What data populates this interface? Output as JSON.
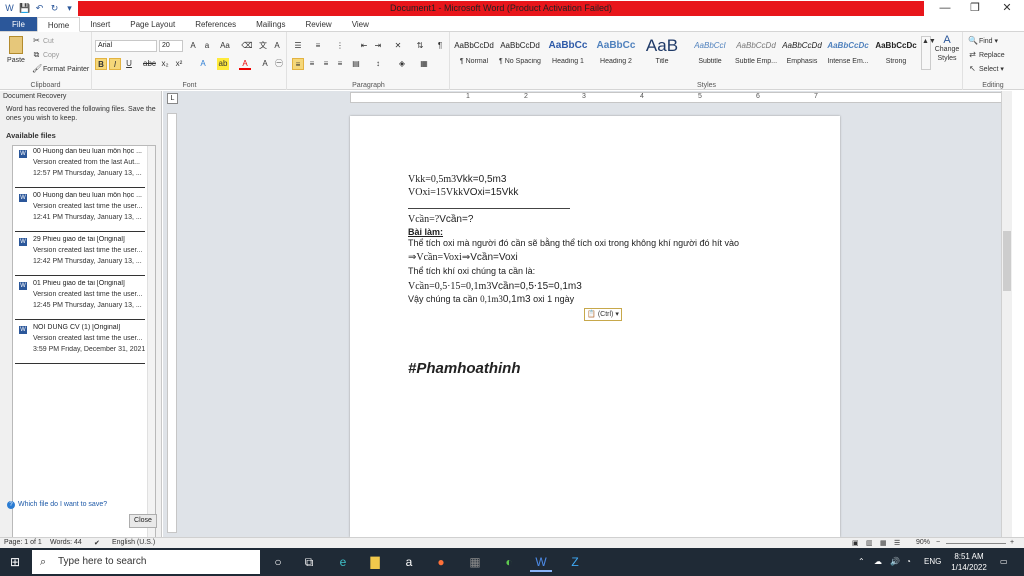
{
  "window": {
    "title": "Document1 - Microsoft Word (Product Activation Failed)",
    "qat": [
      "save-icon",
      "undo-icon",
      "redo-icon",
      "customize-icon"
    ]
  },
  "tabs": [
    "File",
    "Home",
    "Insert",
    "Page Layout",
    "References",
    "Mailings",
    "Review",
    "View"
  ],
  "ribbon": {
    "clipboard": {
      "label": "Clipboard",
      "paste": "Paste",
      "cut": "Cut",
      "copy": "Copy",
      "format_painter": "Format Painter"
    },
    "font": {
      "label": "Font",
      "family": "Arial",
      "size": "20"
    },
    "paragraph": {
      "label": "Paragraph"
    },
    "styles": {
      "label": "Styles",
      "items": [
        {
          "sample": "AaBbCcDd",
          "name": "¶ Normal"
        },
        {
          "sample": "AaBbCcDd",
          "name": "¶ No Spacing"
        },
        {
          "sample": "AaBbCc",
          "name": "Heading 1"
        },
        {
          "sample": "AaBbCc",
          "name": "Heading 2"
        },
        {
          "sample": "AaB",
          "name": "Title"
        },
        {
          "sample": "AaBbCcI",
          "name": "Subtitle"
        },
        {
          "sample": "AaBbCcDd",
          "name": "Subtle Emp..."
        },
        {
          "sample": "AaBbCcDd",
          "name": "Emphasis"
        },
        {
          "sample": "AaBbCcDc",
          "name": "Intense Em..."
        },
        {
          "sample": "AaBbCcDc",
          "name": "Strong"
        }
      ],
      "change_styles": "Change Styles"
    },
    "editing": {
      "label": "Editing",
      "find": "Find",
      "replace": "Replace",
      "select": "Select"
    }
  },
  "recovery": {
    "title": "Document Recovery",
    "message": "Word has recovered the following files.  Save the ones you wish to keep.",
    "available": "Available files",
    "files": [
      {
        "name": "00 Huong dan tieu luan môn học ...",
        "desc": "Version created from the last Aut...",
        "time": "12:57 PM Thursday, January 13, ..."
      },
      {
        "name": "00 Huong dan tieu luan môn học ...",
        "desc": "Version created last time the user...",
        "time": "12:41 PM Thursday, January 13, ..."
      },
      {
        "name": "29 Phieu giao de tai  [Original]",
        "desc": "Version created last time the user...",
        "time": "12:42 PM Thursday, January 13, ..."
      },
      {
        "name": "01 Phieu giao de tai  [Original]",
        "desc": "Version created last time the user...",
        "time": "12:45 PM Thursday, January 13, ..."
      },
      {
        "name": "NOI DUNG CV (1)  [Original]",
        "desc": "Version created last time the user...",
        "time": "3:59 PM Friday, December 31, 2021"
      }
    ],
    "help": "Which file do I want to save?",
    "close": "Close"
  },
  "document": {
    "line1_serif": "Vkk=0,5m3",
    "line1_text": "Vkk=0,5m3",
    "line2_serif": "VOxi=15Vkk",
    "line2_text": "VOxi=15Vkk",
    "line3_serif": "Vcần=?",
    "line3_text": "Vcần=?",
    "line4": "Bài làm:",
    "line5": "Thể tích oxi mà người đó cần sẽ bằng thể tích oxi trong không khí người đó hít vào",
    "line6_serif": "⇒Vcần=Voxi",
    "line6_text": "⇒Vcần=Voxi",
    "line7": "Thể tích khí oxi chúng ta cần là:",
    "line8_serif": "Vcần=0,5⋅15=0,1m3",
    "line8_text": "Vcần=0,5⋅15=0,1m3",
    "line9a": "Vậy chúng ta cần ",
    "line9_serif": "0,1m3",
    "line9_text": "0,1m3",
    "line9b": " oxi 1 ngày",
    "paste_options": "(Ctrl)",
    "signature": "#Phamhoathinh"
  },
  "status": {
    "page": "Page: 1 of 1",
    "words": "Words: 44",
    "language": "English (U.S.)",
    "zoom": "90%"
  },
  "taskbar": {
    "search": "Type here to search",
    "lang": "ENG",
    "time": "8:51 AM",
    "date": "1/14/2022"
  }
}
